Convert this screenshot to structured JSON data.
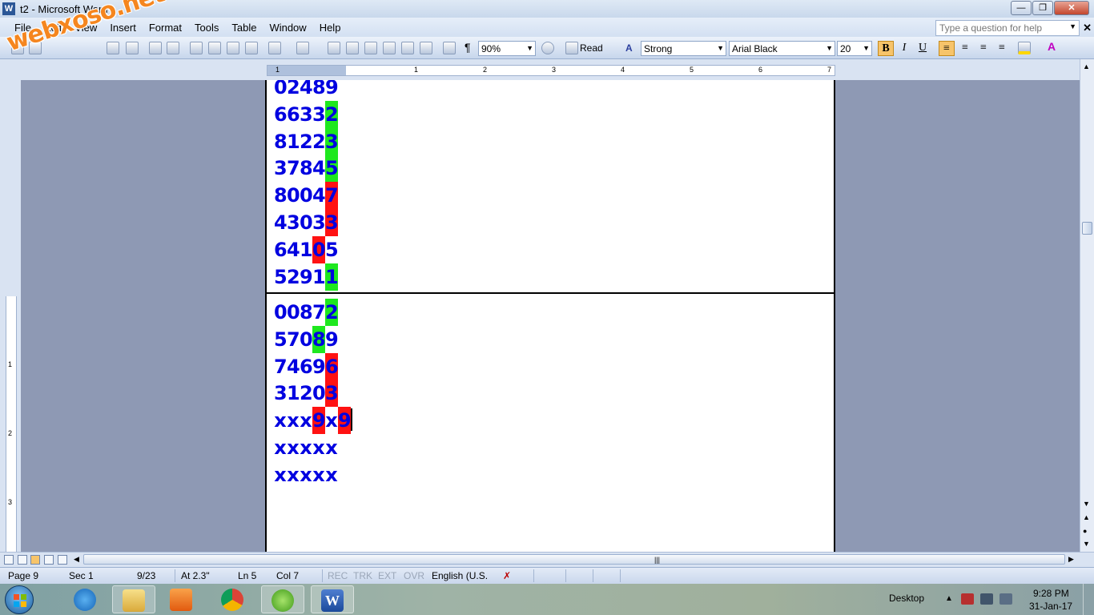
{
  "window": {
    "title": "t2 - Microsoft Word"
  },
  "watermark": {
    "text": "webxoso.net"
  },
  "menubar": {
    "items": [
      "File",
      "Edit",
      "View",
      "Insert",
      "Format",
      "Tools",
      "Table",
      "Window",
      "Help"
    ],
    "help_placeholder": "Type a question for help"
  },
  "toolbar": {
    "zoom": "90%",
    "read_label": "Read",
    "style": "Strong",
    "font": "Arial Black",
    "font_size": "20",
    "bold": "B",
    "italic": "I",
    "underline": "U"
  },
  "ruler": {
    "h_numbers": [
      "1",
      "1",
      "2",
      "3",
      "4",
      "5",
      "6",
      "7"
    ],
    "v_numbers": [
      "1",
      "2",
      "3"
    ]
  },
  "document": {
    "section1": [
      {
        "digits": [
          "0",
          "2",
          "4",
          "8",
          "9"
        ],
        "hl": [
          "",
          "",
          "",
          "",
          ""
        ]
      },
      {
        "digits": [
          "6",
          "6",
          "3",
          "3",
          "2"
        ],
        "hl": [
          "",
          "",
          "",
          "",
          "g"
        ]
      },
      {
        "digits": [
          "8",
          "1",
          "2",
          "2",
          "3"
        ],
        "hl": [
          "",
          "",
          "",
          "",
          "g"
        ]
      },
      {
        "digits": [
          "3",
          "7",
          "8",
          "4",
          "5"
        ],
        "hl": [
          "",
          "",
          "",
          "",
          "g"
        ]
      },
      {
        "digits": [
          "8",
          "0",
          "0",
          "4",
          "7"
        ],
        "hl": [
          "",
          "",
          "",
          "",
          "r"
        ]
      },
      {
        "digits": [
          "4",
          "3",
          "0",
          "3",
          "3"
        ],
        "hl": [
          "",
          "",
          "",
          "",
          "r"
        ]
      },
      {
        "digits": [
          "6",
          "4",
          "1",
          "0",
          "5"
        ],
        "hl": [
          "",
          "",
          "",
          "r",
          ""
        ]
      },
      {
        "digits": [
          "5",
          "2",
          "9",
          "1",
          "1"
        ],
        "hl": [
          "",
          "",
          "",
          "",
          "g"
        ]
      }
    ],
    "section2": [
      {
        "digits": [
          "0",
          "0",
          "8",
          "7",
          "2"
        ],
        "hl": [
          "",
          "",
          "",
          "",
          "g"
        ]
      },
      {
        "digits": [
          "5",
          "7",
          "0",
          "8",
          "9"
        ],
        "hl": [
          "",
          "",
          "",
          "g",
          ""
        ]
      },
      {
        "digits": [
          "7",
          "4",
          "6",
          "9",
          "6"
        ],
        "hl": [
          "",
          "",
          "",
          "",
          "r"
        ]
      },
      {
        "digits": [
          "3",
          "1",
          "2",
          "0",
          "3"
        ],
        "hl": [
          "",
          "",
          "",
          "",
          "r"
        ]
      },
      {
        "digits": [
          "x",
          "x",
          "x",
          "9",
          "x",
          "9"
        ],
        "hl": [
          "",
          "",
          "",
          "r",
          "",
          "r"
        ]
      },
      {
        "digits": [
          "x",
          "x",
          "x",
          "x",
          "x"
        ],
        "hl": [
          "",
          "",
          "",
          "",
          ""
        ]
      },
      {
        "digits": [
          "x",
          "x",
          "x",
          "x",
          "x"
        ],
        "hl": [
          "",
          "",
          "",
          "",
          ""
        ]
      }
    ]
  },
  "statusbar": {
    "page": "Page 9",
    "sec": "Sec 1",
    "pages": "9/23",
    "at": "At 2.3\"",
    "ln": "Ln 5",
    "col": "Col 7",
    "rec": "REC",
    "trk": "TRK",
    "ext": "EXT",
    "ovr": "OVR",
    "language": "English (U.S."
  },
  "taskbar": {
    "desktop_label": "Desktop",
    "time": "9:28 PM",
    "date": "31-Jan-17"
  },
  "colors": {
    "highlight_green": "#1ee81e",
    "highlight_red": "#ff1212",
    "text_blue": "#0000e0"
  }
}
